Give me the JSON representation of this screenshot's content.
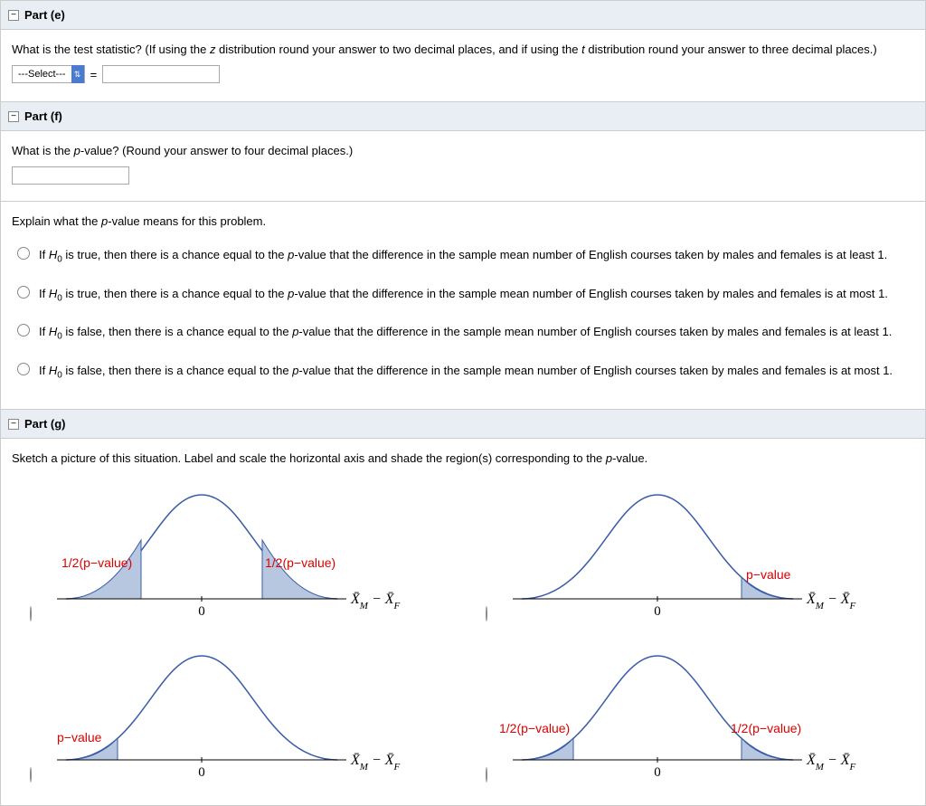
{
  "parts": {
    "e": {
      "title": "Part (e)",
      "question": "What is the test statistic? (If using the z distribution round your answer to two decimal places, and if using the t distribution round your answer to three decimal places.)",
      "select_placeholder": "---Select---",
      "equals": "="
    },
    "f": {
      "title": "Part (f)",
      "question": "What is the p-value? (Round your answer to four decimal places.)",
      "explain": "Explain what the p-value means for this problem.",
      "options": [
        "If H₀ is true, then there is a chance equal to the p-value that the difference in the sample mean number of English courses taken by males and females is at least 1.",
        "If H₀ is true, then there is a chance equal to the p-value that the difference in the sample mean number of English courses taken by males and females is at most 1.",
        "If H₀ is false, then there is a chance equal to the p-value that the difference in the sample mean number of English courses taken by males and females is at least 1.",
        "If H₀ is false, then there is a chance equal to the p-value that the difference in the sample mean number of English courses taken by males and females is at most 1."
      ]
    },
    "g": {
      "title": "Part (g)",
      "question": "Sketch a picture of this situation. Label and scale the horizontal axis and shade the region(s) corresponding to the p-value.",
      "graphs": {
        "axis_label": "X̄_M − X̄_F",
        "zero": "0",
        "half_p": "1/2(p−value)",
        "p": "p−value"
      }
    }
  }
}
